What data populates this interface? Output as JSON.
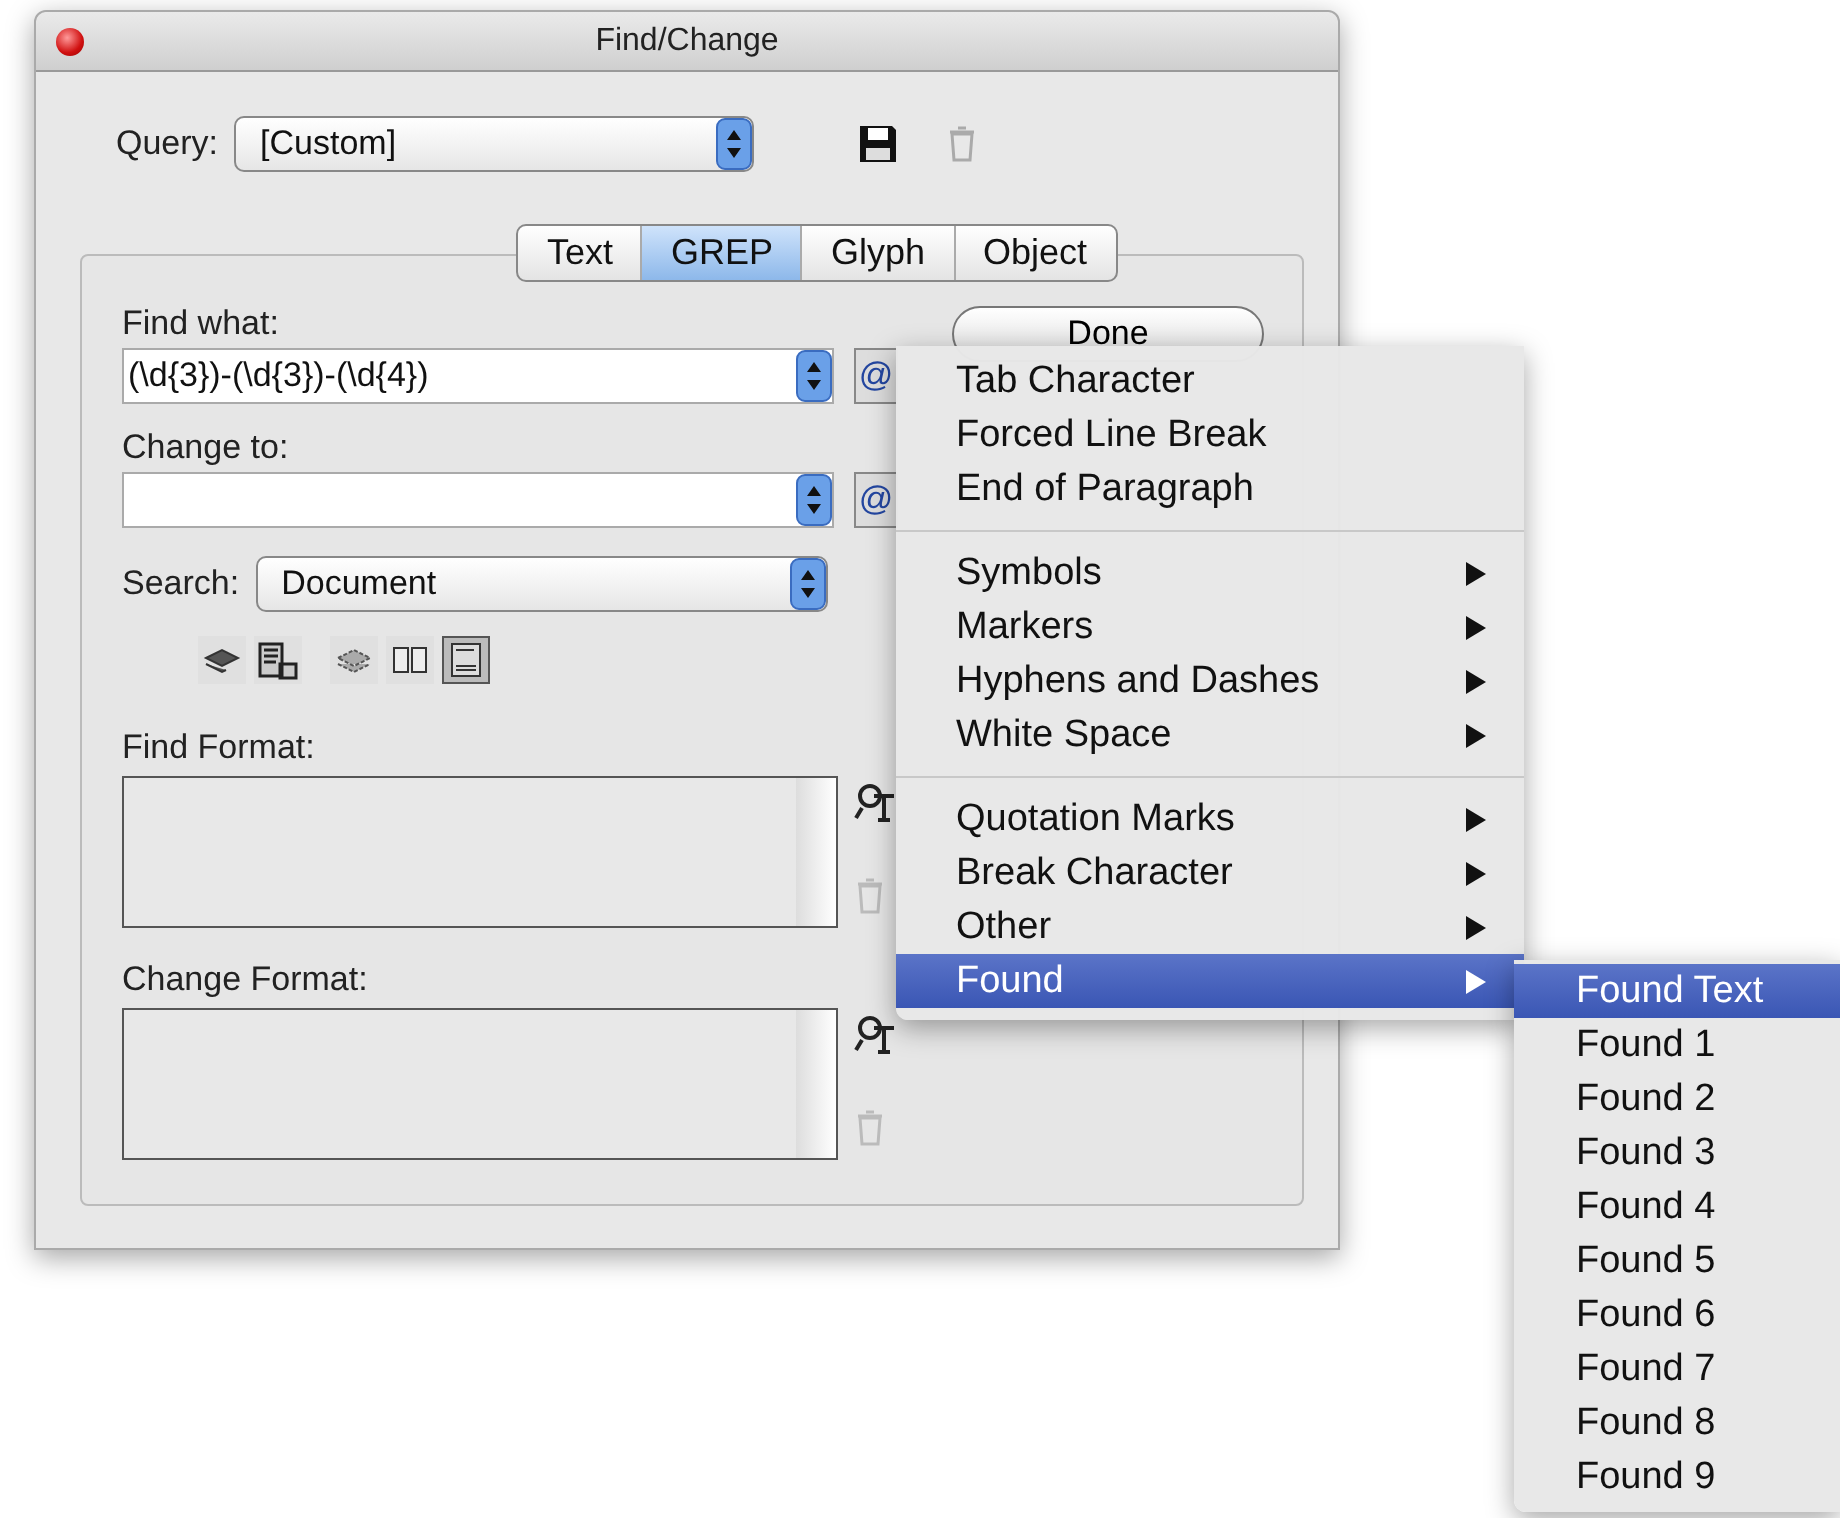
{
  "window": {
    "title": "Find/Change"
  },
  "query": {
    "label": "Query:",
    "value": "[Custom]"
  },
  "tabs": [
    {
      "label": "Text",
      "selected": false
    },
    {
      "label": "GREP",
      "selected": true
    },
    {
      "label": "Glyph",
      "selected": false
    },
    {
      "label": "Object",
      "selected": false
    }
  ],
  "find_what": {
    "label": "Find what:",
    "value": "(\\d{3})-(\\d{3})-(\\d{4})",
    "button": "@"
  },
  "change_to": {
    "label": "Change to:",
    "button": "@"
  },
  "search": {
    "label": "Search:",
    "value": "Document"
  },
  "search_options": [
    {
      "kind": "locked-layers",
      "selected": false
    },
    {
      "kind": "locked-stories",
      "selected": false
    },
    {
      "kind": "hidden-layers",
      "selected": false
    },
    {
      "kind": "master-pages",
      "selected": false
    },
    {
      "kind": "footnotes",
      "selected": true
    }
  ],
  "find_format": {
    "label": "Find Format:"
  },
  "change_format": {
    "label": "Change Format:"
  },
  "done_button": "Done",
  "menu": [
    [
      {
        "label": "Tab Character",
        "submenu": false,
        "selected": false
      },
      {
        "label": "Forced Line Break",
        "submenu": false,
        "selected": false
      },
      {
        "label": "End of Paragraph",
        "submenu": false,
        "selected": false
      }
    ],
    [
      {
        "label": "Symbols",
        "submenu": true,
        "selected": false
      },
      {
        "label": "Markers",
        "submenu": true,
        "selected": false
      },
      {
        "label": "Hyphens and Dashes",
        "submenu": true,
        "selected": false
      },
      {
        "label": "White Space",
        "submenu": true,
        "selected": false
      }
    ],
    [
      {
        "label": "Quotation Marks",
        "submenu": true,
        "selected": false
      },
      {
        "label": "Break Character",
        "submenu": true,
        "selected": false
      },
      {
        "label": "Other",
        "submenu": true,
        "selected": false
      },
      {
        "label": "Found",
        "submenu": true,
        "selected": true
      }
    ]
  ],
  "submenu": [
    {
      "label": "Found Text",
      "selected": true
    },
    {
      "label": "Found 1",
      "selected": false
    },
    {
      "label": "Found 2",
      "selected": false
    },
    {
      "label": "Found 3",
      "selected": false
    },
    {
      "label": "Found 4",
      "selected": false
    },
    {
      "label": "Found 5",
      "selected": false
    },
    {
      "label": "Found 6",
      "selected": false
    },
    {
      "label": "Found 7",
      "selected": false
    },
    {
      "label": "Found 8",
      "selected": false
    },
    {
      "label": "Found 9",
      "selected": false
    }
  ]
}
